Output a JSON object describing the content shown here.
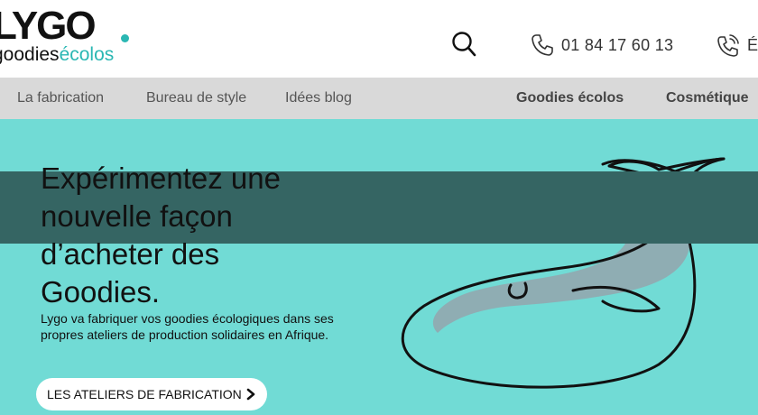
{
  "header": {
    "logo": {
      "word": "LYGO",
      "tagline_part1": "goodies",
      "tagline_part2": "écolos"
    },
    "search_icon": "search-icon",
    "phone": "01 84 17 60 13",
    "phone2_text": "É"
  },
  "nav": {
    "items": [
      {
        "label": "La fabrication"
      },
      {
        "label": "Bureau de style"
      },
      {
        "label": "Idées blog"
      },
      {
        "label": "Goodies écolos"
      },
      {
        "label": "Cosmétique"
      }
    ]
  },
  "hero": {
    "title": "Expérimentez une nouvelle façon d’acheter des Goodies.",
    "description": "Lygo va fabriquer vos  goodies écologiques dans ses propres ateliers de production solidaires en Afrique.",
    "cta_label": "LES ATELIERS DE FABRICATION",
    "colors": {
      "background": "#71dbd5",
      "band": "#356563",
      "logo_accent": "#2ab7b3"
    }
  }
}
